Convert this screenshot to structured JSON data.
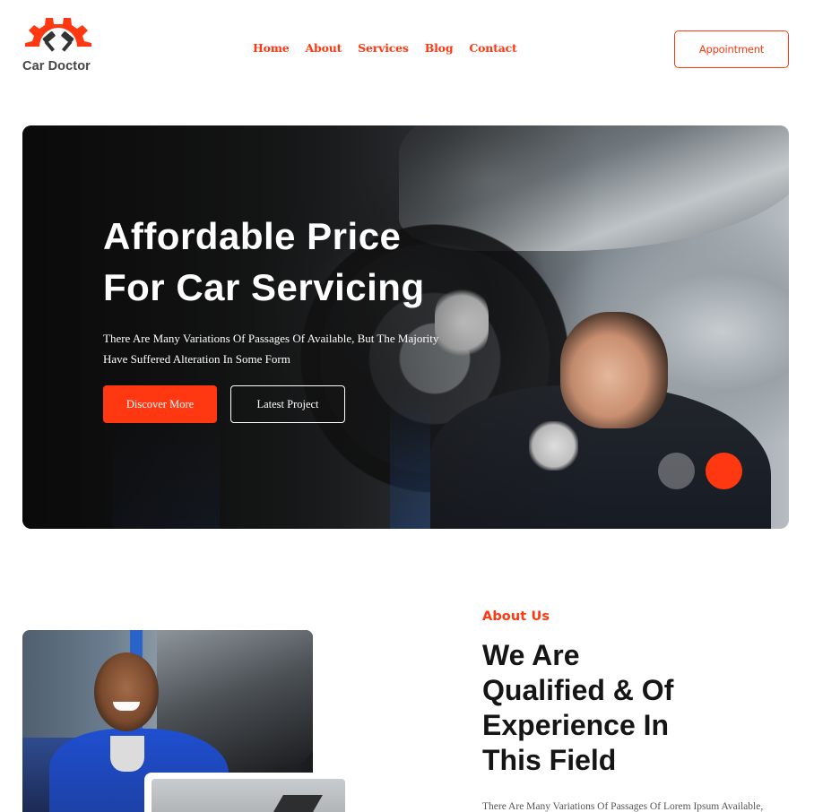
{
  "brand": {
    "name": "Car Doctor",
    "accent_color": "#FF3811",
    "icon": "gear-pistons-logo"
  },
  "nav": {
    "items": [
      "Home",
      "About",
      "Services",
      "Blog",
      "Contact"
    ]
  },
  "header": {
    "appointment_label": "Appointment"
  },
  "hero": {
    "title_line1": "Affordable Price",
    "title_line2": "For Car Servicing",
    "subtitle_line1": "There Are Many Variations Of Passages Of Available, But The Majority",
    "subtitle_line2": "Have Suffered Alteration In Some Form",
    "primary_button": "Discover More",
    "secondary_button": "Latest Project",
    "prev_icon": "arrow-left-icon",
    "next_icon": "arrow-right-icon"
  },
  "about": {
    "label": "About Us",
    "title_line1": "We Are",
    "title_line2": "Qualified & Of",
    "title_line3": "Experience In",
    "title_line4": "This Field",
    "text": "There Are Many Variations Of Passages Of Lorem Ipsum Available,"
  }
}
